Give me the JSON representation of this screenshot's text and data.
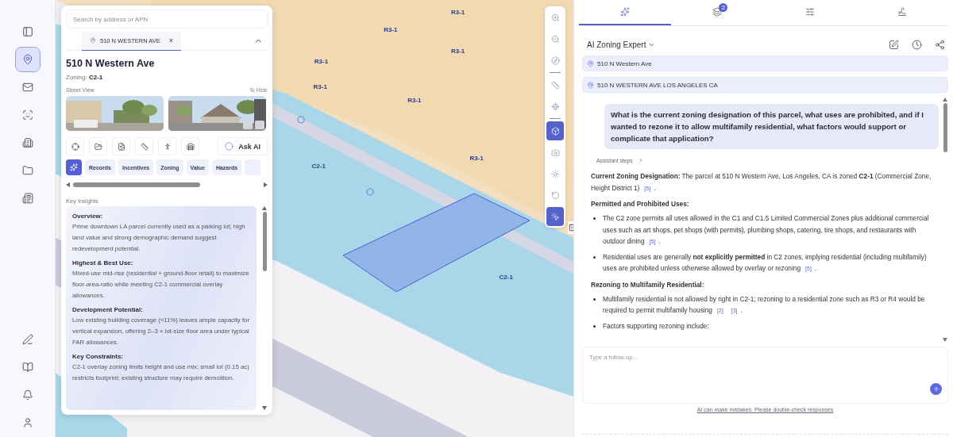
{
  "rail": {
    "top": [
      {
        "kind": "panel",
        "selected": false
      },
      {
        "kind": "pin",
        "selected": true
      },
      {
        "kind": "mail",
        "selected": false
      },
      {
        "kind": "face",
        "selected": false
      },
      {
        "kind": "building",
        "selected": false
      },
      {
        "kind": "folder",
        "selected": false
      },
      {
        "kind": "news",
        "selected": false
      }
    ],
    "bottom": [
      {
        "kind": "pen",
        "selected": false
      },
      {
        "kind": "book",
        "selected": false
      },
      {
        "kind": "bell",
        "selected": false
      },
      {
        "kind": "user",
        "selected": false
      }
    ]
  },
  "map": {
    "labels": [
      "R3-1",
      "R3-1",
      "R3-1",
      "R3-1",
      "R3-1",
      "R3-1",
      "R3-1",
      "C2-1",
      "C2-1"
    ],
    "toolbar": [
      {
        "kind": "zoom-in",
        "active": false
      },
      {
        "kind": "zoom-out",
        "active": false
      },
      {
        "kind": "compass",
        "active": false
      },
      {
        "kind": "divider"
      },
      {
        "kind": "ruler",
        "active": false
      },
      {
        "kind": "locate",
        "active": false
      },
      {
        "kind": "divider"
      },
      {
        "kind": "cube",
        "active": true
      },
      {
        "kind": "camera",
        "active": false
      },
      {
        "kind": "sun",
        "active": false
      },
      {
        "kind": "rotate",
        "active": false
      },
      {
        "kind": "pointer",
        "active": true
      }
    ]
  },
  "panel": {
    "search": {
      "placeholder": "Search by address or APN"
    },
    "address_tab": {
      "label": "510 N WESTERN AVE",
      "close": "×"
    },
    "title": "510 N Western Ave",
    "zoning": "Zoning: **C2-1**",
    "street_view": {
      "label": "Street View",
      "hide": "Hide",
      "photos": [
        {
          "kind": "picture",
          "controls": false
        },
        {
          "kind": "picture",
          "controls": true
        }
      ]
    },
    "tools": [
      {
        "kind": "target"
      },
      {
        "kind": "folder"
      },
      {
        "kind": "file"
      },
      {
        "kind": "ruler"
      },
      {
        "kind": "walk"
      },
      {
        "kind": "house"
      }
    ],
    "ask_ai": "Ask AI",
    "chips": [
      {
        "kind": "ai",
        "selected": true
      },
      {
        "kind": "chip",
        "label": "Records",
        "selected": false
      },
      {
        "kind": "chip",
        "label": "Incentives",
        "selected": false
      },
      {
        "kind": "chip",
        "label": "Zoning",
        "selected": false
      },
      {
        "kind": "chip",
        "label": "Value",
        "selected": false
      },
      {
        "kind": "chip",
        "label": "Hazards",
        "selected": false
      },
      {
        "kind": "partial",
        "selected": false
      }
    ],
    "key_insights": {
      "title": "Key Insights",
      "sections": [
        {
          "heading": "Overview:",
          "text": "Prime downtown LA parcel currently used as a parking lot; high land value and strong demographic demand suggest redevelopment potential."
        },
        {
          "heading": "Highest & Best Use:",
          "text": "Mixed-use mid-rise (residential + ground-floor retail) to maximize floor-area-ratio while meeting C2-1 commercial overlay allowances."
        },
        {
          "heading": "Development Potential:",
          "text": "Low existing building coverage (≈11%) leaves ample capacity for vertical expansion, offering 2–3 × lot-size floor area under typical FAR allowances."
        },
        {
          "heading": "Key Constraints:",
          "text": "C2-1 overlay zoning limits height and use mix; small lot (0.15 ac) restricts footprint; existing structure may require demolition."
        }
      ]
    }
  },
  "assistant": {
    "tabs": [
      {
        "kind": "ai",
        "selected": true
      },
      {
        "kind": "layers",
        "selected": false,
        "badge": "2"
      },
      {
        "kind": "filters",
        "selected": false
      },
      {
        "kind": "draw",
        "selected": false
      }
    ],
    "name": "AI Zoning Expert",
    "actions": [
      {
        "kind": "edit"
      },
      {
        "kind": "history"
      },
      {
        "kind": "share"
      }
    ],
    "locations": [
      "510 N Western Ave",
      "510 N WESTERN AVE LOS ANGELES CA"
    ],
    "question": "What is the current zoning designation of this parcel, what uses are prohibited, and if I wanted to rezone it to allow multifamily residential, what factors would support or complicate that application?",
    "steps": "Assistant steps",
    "answer": [
      {
        "kind": "paragraph",
        "text": "**Current Zoning Designation:** The parcel at 510 N Western Ave, Los Angeles, CA is zoned **C2-1** (Commercial Zone, Height District 1)",
        "citations": [
          "[5]"
        ],
        "tail": "."
      },
      {
        "kind": "heading",
        "text": "Permitted and Prohibited Uses:"
      },
      {
        "kind": "bullet",
        "text": "The C2 zone permits all uses allowed in the C1 and C1.5 Limited Commercial Zones plus additional commercial uses such as art shops, pet shops (with permits), plumbing shops, catering, tire shops, and restaurants with outdoor dining",
        "citations": [
          "[5]"
        ],
        "tail": "."
      },
      {
        "kind": "bullet",
        "text": "Residential uses are generally **not explicitly permitted** in C2 zones, implying residential (including multifamily) uses are prohibited unless otherwise allowed by overlay or rezoning",
        "citations": [
          "[5]"
        ],
        "tail": "."
      },
      {
        "kind": "heading",
        "text": "Rezoning to Multifamily Residential:"
      },
      {
        "kind": "bullet",
        "text": "Multifamily residential is not allowed by right in C2-1; rezoning to a residential zone such as R3 or R4 would be required to permit multifamily housing",
        "citations": [
          "[2]",
          "[3]"
        ],
        "tail": "."
      },
      {
        "kind": "bullet",
        "text": "Factors supporting rezoning include:"
      }
    ],
    "input": {
      "placeholder": "Type a follow-up..."
    },
    "disclaimer": "AI can make mistakes. Please double-check responses"
  }
}
